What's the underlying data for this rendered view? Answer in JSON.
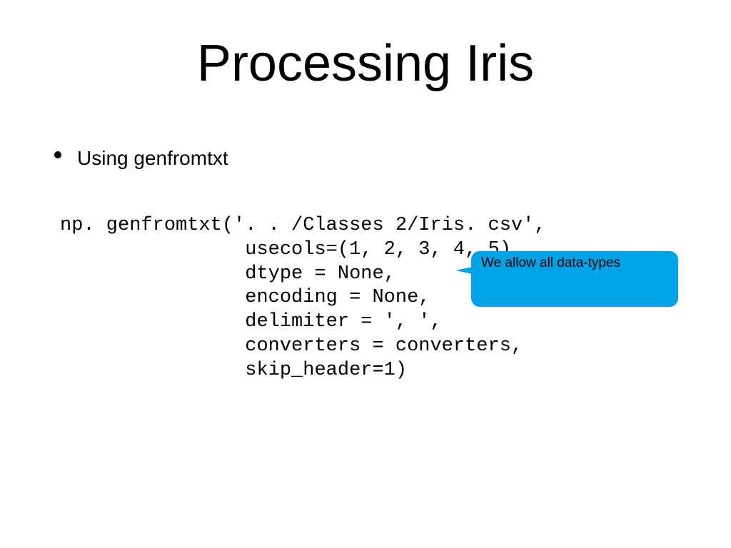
{
  "title": "Processing Iris",
  "bullet": "Using genfromtxt",
  "code": "np. genfromtxt('. . /Classes 2/Iris. csv',\n                usecols=(1, 2, 3, 4, 5),\n                dtype = None,\n                encoding = None,\n                delimiter = ', ',\n                converters = converters,\n                skip_header=1)",
  "callout": "We allow all data-types"
}
